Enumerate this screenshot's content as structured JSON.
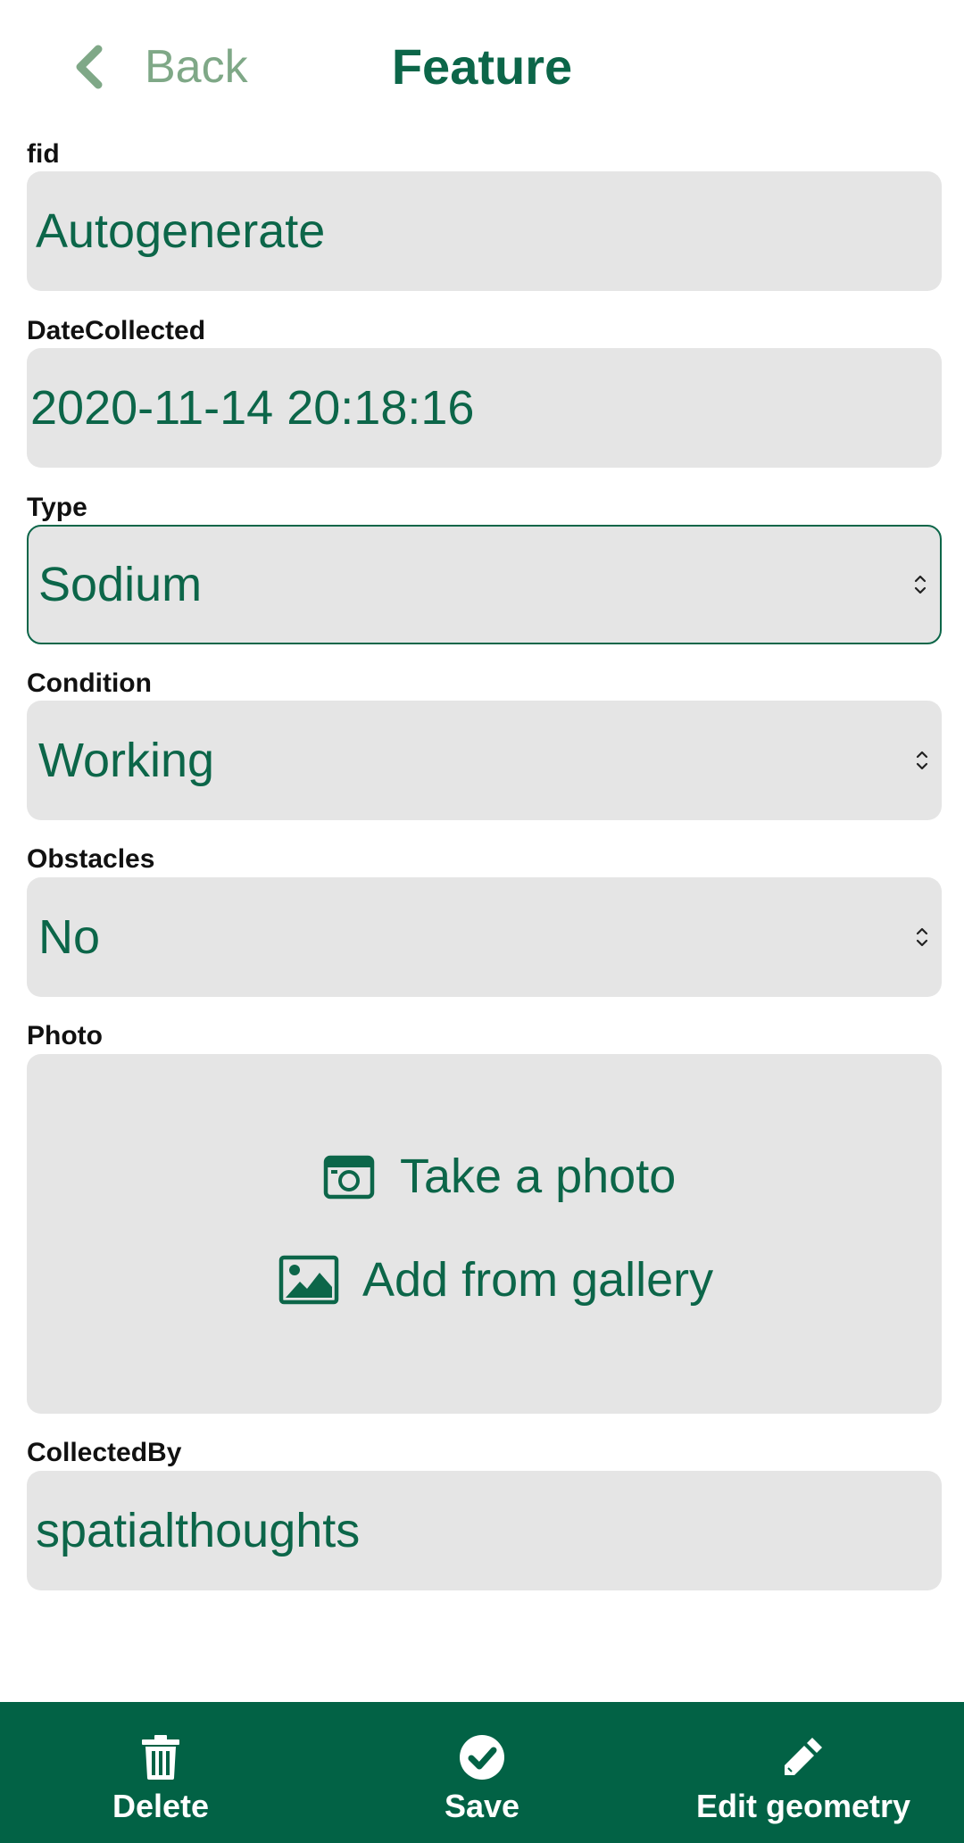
{
  "header": {
    "back_label": "Back",
    "title": "Feature"
  },
  "fields": [
    {
      "label": "fid",
      "value": "Autogenerate",
      "kind": "text"
    },
    {
      "label": "DateCollected",
      "value": "2020-11-14 20:18:16",
      "kind": "text"
    },
    {
      "label": "Type",
      "value": "Sodium",
      "kind": "select",
      "focused": true
    },
    {
      "label": "Condition",
      "value": "Working",
      "kind": "select"
    },
    {
      "label": "Obstacles",
      "value": "No",
      "kind": "select"
    }
  ],
  "photo": {
    "label": "Photo",
    "take_photo": "Take a photo",
    "add_gallery": "Add from gallery",
    "camera_icon": "camera-icon",
    "gallery_icon": "image-icon"
  },
  "collected_by": {
    "label": "CollectedBy",
    "value": "spatialthoughts"
  },
  "toolbar": {
    "delete_label": "Delete",
    "save_label": "Save",
    "edit_geometry_label": "Edit geometry"
  },
  "colors": {
    "accent": "#0c6649",
    "back_text": "#7fa887",
    "field_bg": "#e5e5e5",
    "toolbar_bg": "#026245"
  }
}
